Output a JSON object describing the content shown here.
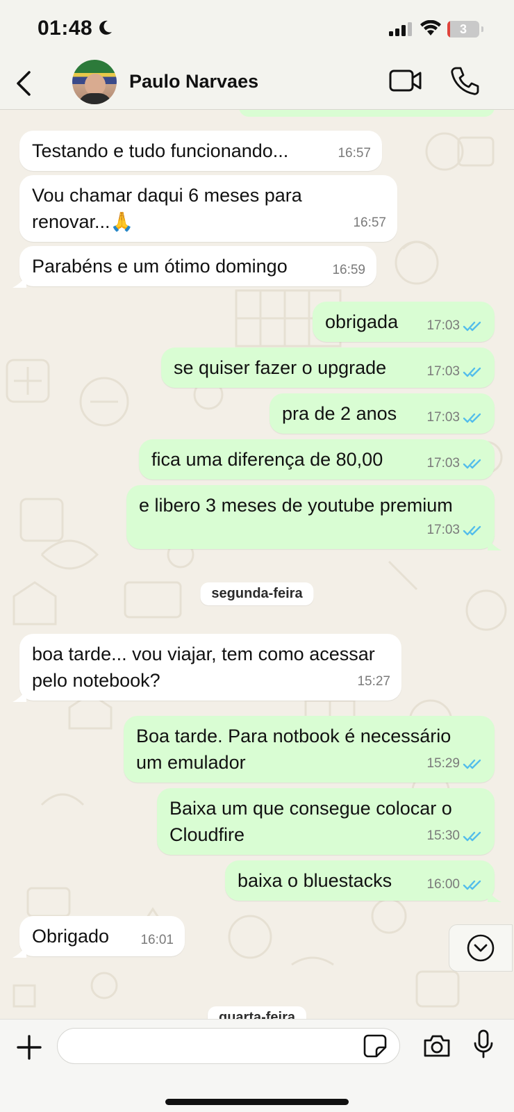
{
  "status_bar": {
    "time": "01:48",
    "battery_level": "3"
  },
  "header": {
    "contact_name": "Paulo Narvaes"
  },
  "messages": [
    {
      "dir": "in",
      "text": "Testando e tudo funcionando...",
      "time": "16:57"
    },
    {
      "dir": "in",
      "text": "Vou chamar daqui 6 meses para renovar...🙏",
      "time": "16:57"
    },
    {
      "dir": "in",
      "text": "Parabéns e um ótimo domingo",
      "time": "16:59"
    },
    {
      "dir": "out",
      "text": "obrigada",
      "time": "17:03"
    },
    {
      "dir": "out",
      "text": "se quiser fazer o upgrade",
      "time": "17:03"
    },
    {
      "dir": "out",
      "text": "pra de 2 anos",
      "time": "17:03"
    },
    {
      "dir": "out",
      "text": "fica uma diferença de 80,00",
      "time": "17:03"
    },
    {
      "dir": "out",
      "text": "e libero 3 meses de youtube premium",
      "time": "17:03"
    },
    {
      "dir": "in",
      "text": "boa tarde... vou viajar, tem como acessar pelo notebook?",
      "time": "15:27"
    },
    {
      "dir": "out",
      "text": "Boa tarde. Para notbook é necessário um emulador",
      "time": "15:29"
    },
    {
      "dir": "out",
      "text": "Baixa um que consegue colocar o Cloudfire",
      "time": "15:30"
    },
    {
      "dir": "out",
      "text": "baixa o bluestacks",
      "time": "16:00"
    },
    {
      "dir": "in",
      "text": "Obrigado",
      "time": "16:01"
    }
  ],
  "date_separators": [
    "segunda-feira",
    "quarta-feira"
  ],
  "input": {
    "value": ""
  },
  "colors": {
    "incoming_bubble": "#ffffff",
    "outgoing_bubble": "#d9fdd3",
    "read_ticks": "#53bdeb",
    "chat_background": "#f3efe7"
  },
  "icons": [
    "moon-icon",
    "signal-icon",
    "wifi-icon",
    "battery-icon",
    "back-chevron-icon",
    "video-camera-icon",
    "phone-icon",
    "double-check-icon",
    "chevron-down-icon",
    "plus-icon",
    "sticker-icon",
    "camera-icon",
    "microphone-icon"
  ]
}
